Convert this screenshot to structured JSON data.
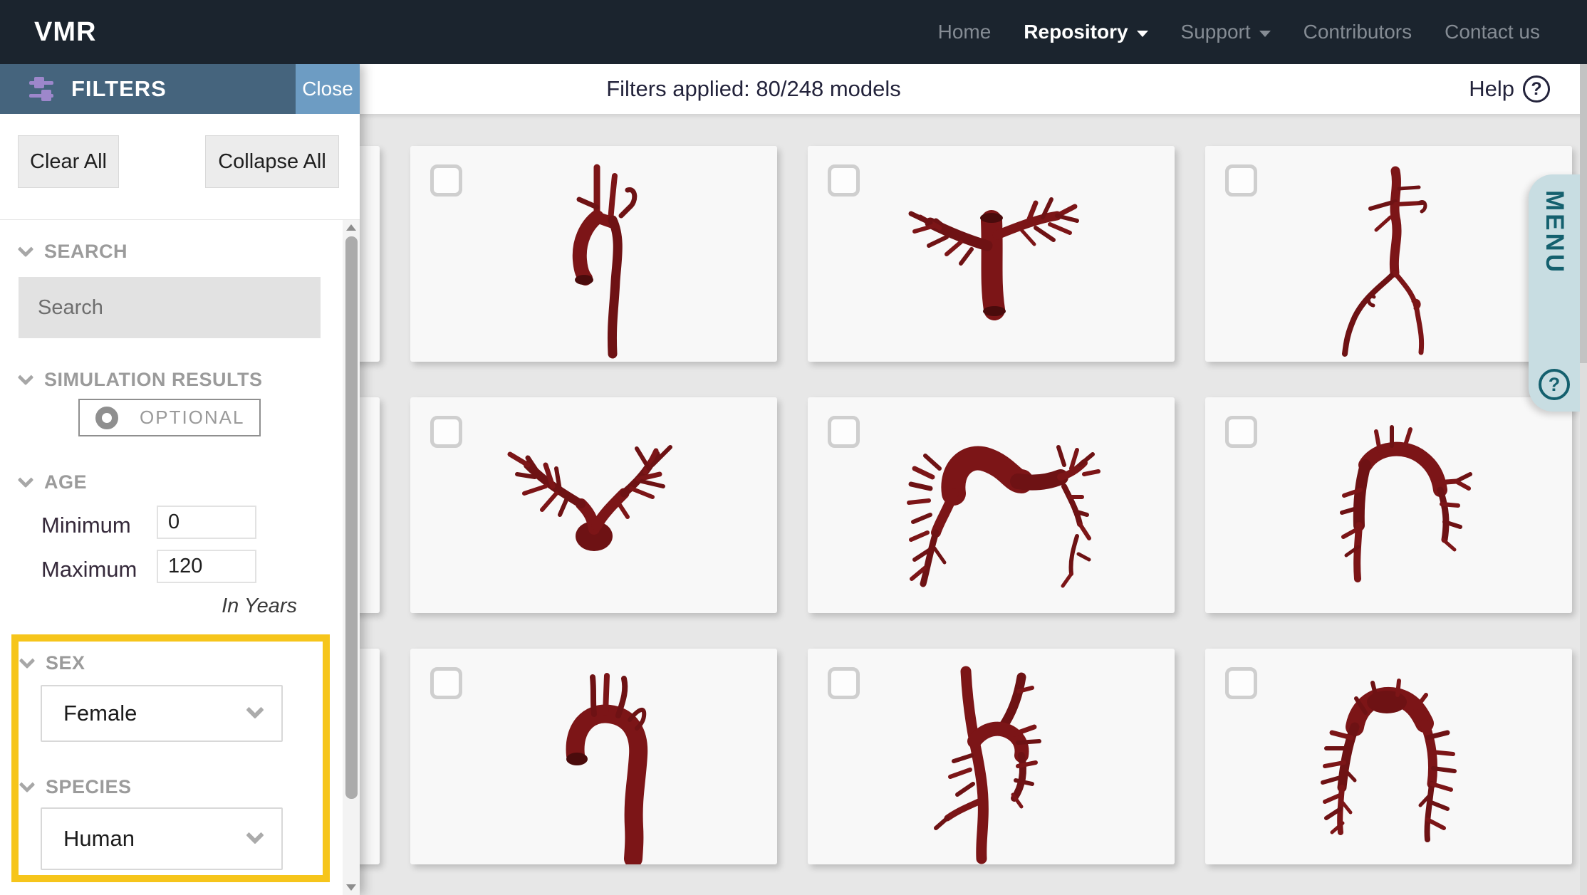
{
  "navbar": {
    "logo": "VMR",
    "items": [
      {
        "label": "Home",
        "active": false,
        "has_dropdown": false
      },
      {
        "label": "Repository",
        "active": true,
        "has_dropdown": true
      },
      {
        "label": "Support",
        "active": false,
        "has_dropdown": true
      },
      {
        "label": "Contributors",
        "active": false,
        "has_dropdown": false
      },
      {
        "label": "Contact us",
        "active": false,
        "has_dropdown": false
      }
    ]
  },
  "toolbar": {
    "status": "Filters applied: 80/248 models",
    "help_label": "Help",
    "help_icon": "circled-question-mark"
  },
  "filters": {
    "title": "FILTERS",
    "header_icon": "sliders-filter-icon",
    "close_label": "Close",
    "clear_all_label": "Clear All",
    "collapse_all_label": "Collapse All",
    "sections": {
      "search": {
        "title": "SEARCH",
        "placeholder": "Search"
      },
      "simulation_results": {
        "title": "SIMULATION RESULTS",
        "optional_label": "OPTIONAL",
        "toggle_state": "off"
      },
      "age": {
        "title": "AGE",
        "min_label": "Minimum",
        "min_value": "0",
        "max_label": "Maximum",
        "max_value": "120",
        "unit_note": "In Years"
      },
      "sex": {
        "title": "SEX",
        "value": "Female"
      },
      "species": {
        "title": "SPECIES",
        "value": "Human"
      }
    },
    "highlighted_sections": [
      "SEX",
      "SPECIES"
    ]
  },
  "menu_tab": {
    "label": "MENU",
    "help_icon": "circled-question-mark"
  },
  "cards": [
    {
      "position": "row1-col0",
      "partial": true,
      "model": null
    },
    {
      "position": "row1-col1",
      "partial": false,
      "model": "aortic-arch-side"
    },
    {
      "position": "row1-col2",
      "partial": false,
      "model": "pulmonary-artery-front"
    },
    {
      "position": "row1-col3",
      "partial": false,
      "model": "aorto-iliac-arteries"
    },
    {
      "position": "row2-col0",
      "partial": true,
      "model": null
    },
    {
      "position": "row2-col1",
      "partial": false,
      "model": "pulmonary-antler-tree"
    },
    {
      "position": "row2-col2",
      "partial": false,
      "model": "pulmonary-arch-lateral"
    },
    {
      "position": "row2-col3",
      "partial": false,
      "model": "aortic-arch-branches"
    },
    {
      "position": "row3-col0",
      "partial": true,
      "model": null
    },
    {
      "position": "row3-col1",
      "partial": false,
      "model": "aortic-arch-cane"
    },
    {
      "position": "row3-col2",
      "partial": false,
      "model": "aorta-branches-front"
    },
    {
      "position": "row3-col3",
      "partial": false,
      "model": "pulmonary-tree-wide"
    }
  ],
  "colors": {
    "navbar_bg": "#1b242e",
    "filters_header_bg": "#45647d",
    "close_button_bg": "#6d9cc3",
    "filter_icon_purple": "#9d87cb",
    "highlight_yellow": "#f6c51b",
    "menu_tab_bg": "#c8dde2",
    "menu_tab_text": "#14606e",
    "vessel_red": "#7c1517",
    "card_bg": "#f8f8f8",
    "page_bg": "#e7e7e7"
  }
}
